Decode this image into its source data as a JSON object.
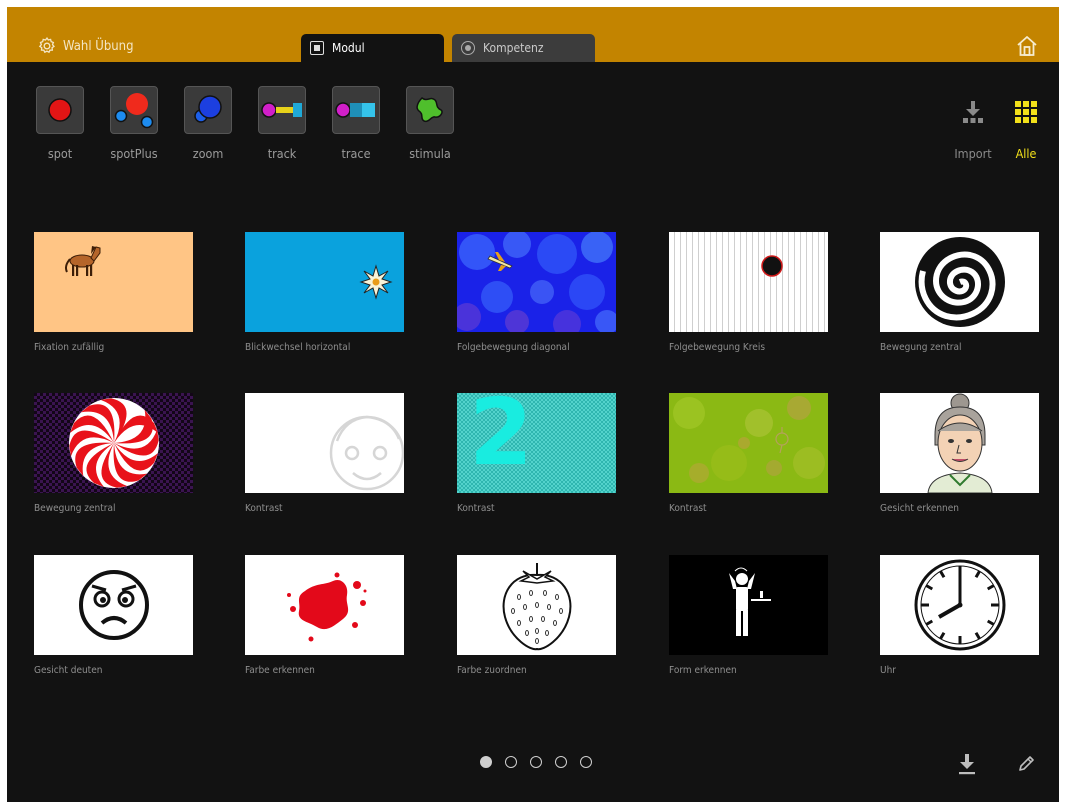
{
  "header": {
    "title": "Wahl Übung",
    "tabs": [
      {
        "label": "Modul",
        "active": true
      },
      {
        "label": "Kompetenz",
        "active": false
      }
    ],
    "home_icon": "home-icon",
    "accent_color": "#c38400"
  },
  "modules": [
    {
      "label": "spot",
      "icon": "spot-icon"
    },
    {
      "label": "spotPlus",
      "icon": "spotplus-icon"
    },
    {
      "label": "zoom",
      "icon": "zoom-icon"
    },
    {
      "label": "track",
      "icon": "track-icon"
    },
    {
      "label": "trace",
      "icon": "trace-icon"
    },
    {
      "label": "stimula",
      "icon": "stimula-icon"
    }
  ],
  "filters": {
    "import_label": "Import",
    "all_label": "Alle",
    "active": "Alle",
    "active_color": "#f2e01a"
  },
  "exercises": [
    {
      "caption": "Fixation zufällig"
    },
    {
      "caption": "Blickwechsel horizontal"
    },
    {
      "caption": "Folgebewegung diagonal"
    },
    {
      "caption": "Folgebewegung Kreis"
    },
    {
      "caption": "Bewegung zentral"
    },
    {
      "caption": "Bewegung zentral"
    },
    {
      "caption": "Kontrast"
    },
    {
      "caption": "Kontrast",
      "digit": "2"
    },
    {
      "caption": "Kontrast"
    },
    {
      "caption": "Gesicht erkennen"
    },
    {
      "caption": "Gesicht deuten"
    },
    {
      "caption": "Farbe erkennen"
    },
    {
      "caption": "Farbe zuordnen"
    },
    {
      "caption": "Form erkennen"
    },
    {
      "caption": "Uhr"
    }
  ],
  "pagination": {
    "pages": 5,
    "current": 1
  },
  "footer": {
    "download_icon": "download-icon",
    "edit_icon": "pencil-icon"
  }
}
